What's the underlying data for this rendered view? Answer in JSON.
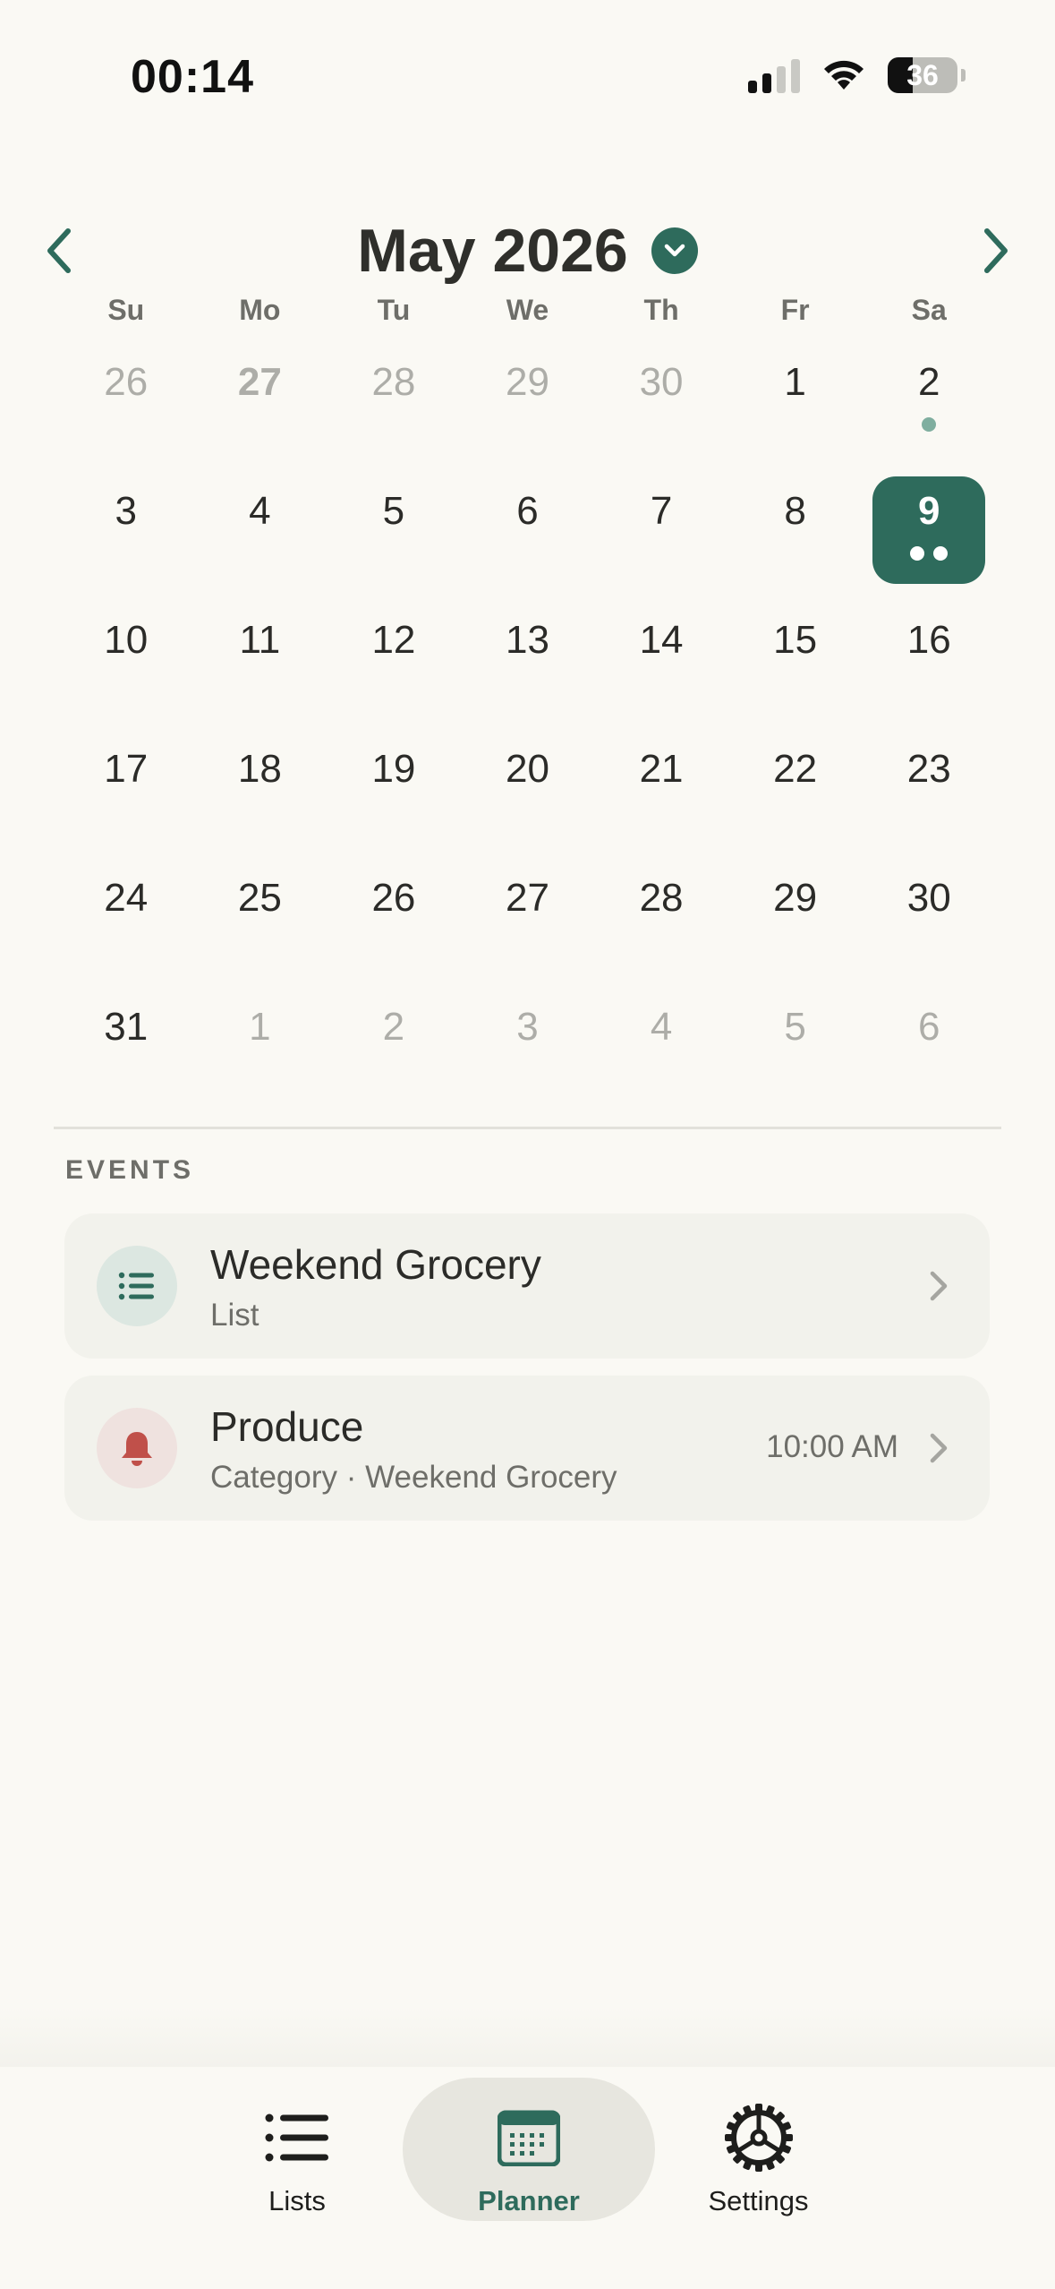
{
  "status_bar": {
    "time": "00:14",
    "battery_level": "36"
  },
  "calendar": {
    "month_title": "May 2026",
    "weekdays": [
      "Su",
      "Mo",
      "Tu",
      "We",
      "Th",
      "Fr",
      "Sa"
    ],
    "weeks": [
      [
        {
          "label": "26",
          "outside": true
        },
        {
          "label": "27",
          "outside": true,
          "bold": true
        },
        {
          "label": "28",
          "outside": true
        },
        {
          "label": "29",
          "outside": true
        },
        {
          "label": "30",
          "outside": true
        },
        {
          "label": "1"
        },
        {
          "label": "2",
          "dots": 1
        }
      ],
      [
        {
          "label": "3"
        },
        {
          "label": "4"
        },
        {
          "label": "5"
        },
        {
          "label": "6"
        },
        {
          "label": "7"
        },
        {
          "label": "8"
        },
        {
          "label": "9",
          "selected": true,
          "dots": 2
        }
      ],
      [
        {
          "label": "10"
        },
        {
          "label": "11"
        },
        {
          "label": "12"
        },
        {
          "label": "13"
        },
        {
          "label": "14"
        },
        {
          "label": "15"
        },
        {
          "label": "16"
        }
      ],
      [
        {
          "label": "17"
        },
        {
          "label": "18"
        },
        {
          "label": "19"
        },
        {
          "label": "20"
        },
        {
          "label": "21"
        },
        {
          "label": "22"
        },
        {
          "label": "23"
        }
      ],
      [
        {
          "label": "24"
        },
        {
          "label": "25"
        },
        {
          "label": "26"
        },
        {
          "label": "27"
        },
        {
          "label": "28"
        },
        {
          "label": "29"
        },
        {
          "label": "30"
        }
      ],
      [
        {
          "label": "31"
        },
        {
          "label": "1",
          "outside": true
        },
        {
          "label": "2",
          "outside": true
        },
        {
          "label": "3",
          "outside": true
        },
        {
          "label": "4",
          "outside": true
        },
        {
          "label": "5",
          "outside": true
        },
        {
          "label": "6",
          "outside": true
        }
      ]
    ]
  },
  "events": {
    "section_label": "EVENTS",
    "items": [
      {
        "title": "Weekend Grocery",
        "subtitle": "List",
        "time": "",
        "icon": "list-icon"
      },
      {
        "title": "Produce",
        "subtitle": "Category · Weekend Grocery",
        "time": "10:00 AM",
        "icon": "bell-icon"
      }
    ]
  },
  "tabs": {
    "lists": "Lists",
    "planner": "Planner",
    "settings": "Settings",
    "active": "planner"
  },
  "colors": {
    "accent": "#2E6B5C",
    "background": "#FAF9F4",
    "card": "#F2F2EC",
    "bell": "#C0504A",
    "dot": "#7FAE9F"
  }
}
